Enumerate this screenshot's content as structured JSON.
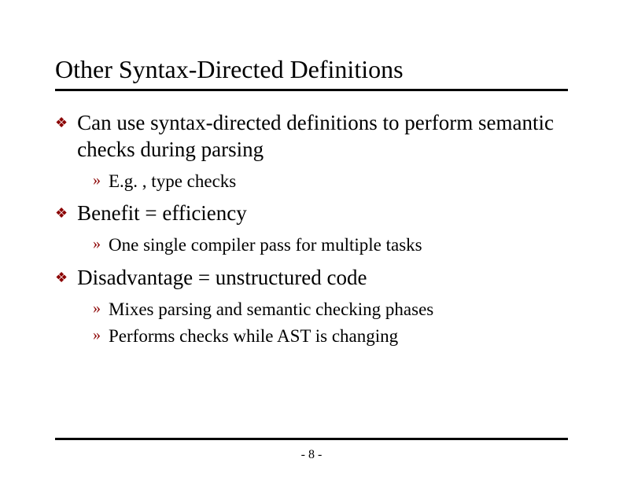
{
  "title": "Other Syntax-Directed Definitions",
  "bullets": [
    {
      "text": "Can use syntax-directed definitions to perform semantic checks during parsing",
      "sub": [
        "E.g. , type checks"
      ]
    },
    {
      "text": "Benefit = efficiency",
      "sub": [
        "One single compiler pass for multiple tasks"
      ]
    },
    {
      "text": "Disadvantage = unstructured code",
      "sub": [
        "Mixes parsing and semantic checking phases",
        "Performs checks while AST is changing"
      ]
    }
  ],
  "page": "- 8 -"
}
